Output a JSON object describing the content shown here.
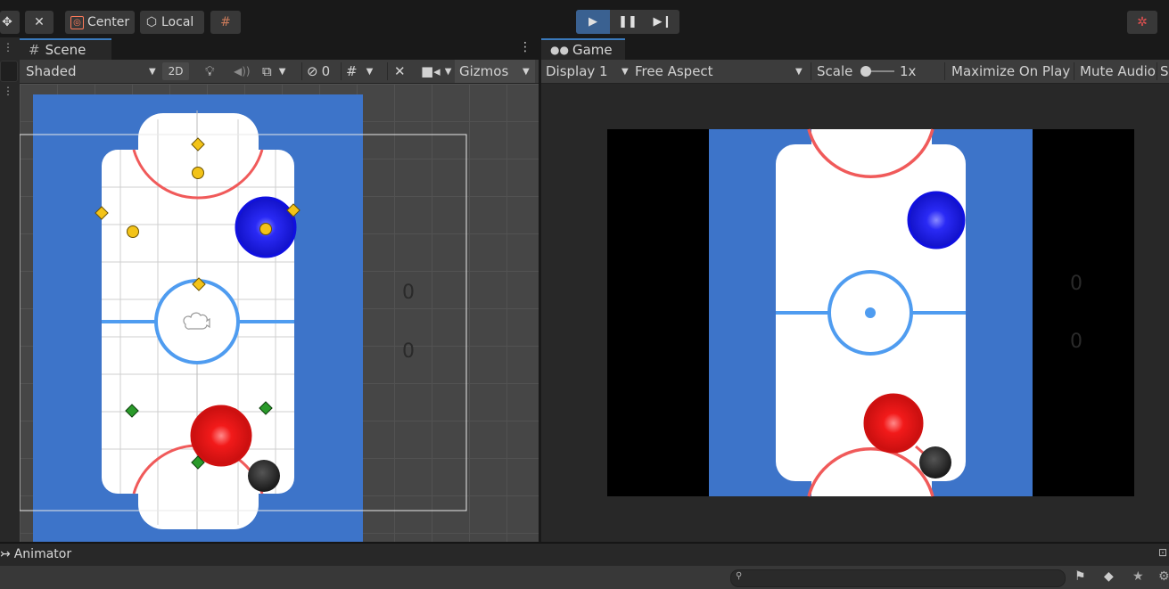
{
  "toolbar": {
    "pivot_label": "Center",
    "space_label": "Local",
    "icons": [
      "move-tool-icon",
      "tools-icon",
      "pivot-center-icon",
      "pivot-local-icon",
      "grid-snap-icon",
      "play-icon",
      "pause-icon",
      "step-icon",
      "collab-icon"
    ]
  },
  "scene_panel": {
    "tab_label": "Scene",
    "shading_mode": "Shaded",
    "mode_2d": "2D",
    "hidden_count": "0",
    "gizmos_label": "Gizmos"
  },
  "game_panel": {
    "tab_label": "Game",
    "display": "Display 1",
    "aspect": "Free Aspect",
    "scale_label": "Scale",
    "scale_value": "1x",
    "maximize_label": "Maximize On Play",
    "mute_label": "Mute Audio",
    "stats_label": "S"
  },
  "game": {
    "score_top": "0",
    "score_bottom": "0"
  },
  "bottom": {
    "animator_label": "Animator",
    "search_placeholder": ""
  },
  "colors": {
    "accent": "#3a79bb",
    "rink_blue": "#3d74c9",
    "line_red": "#f05a5a",
    "line_blue": "#4f9cf0",
    "paddle_blue": "#1a1af0",
    "paddle_red": "#ee1111",
    "puck": "#2a2a2a"
  }
}
